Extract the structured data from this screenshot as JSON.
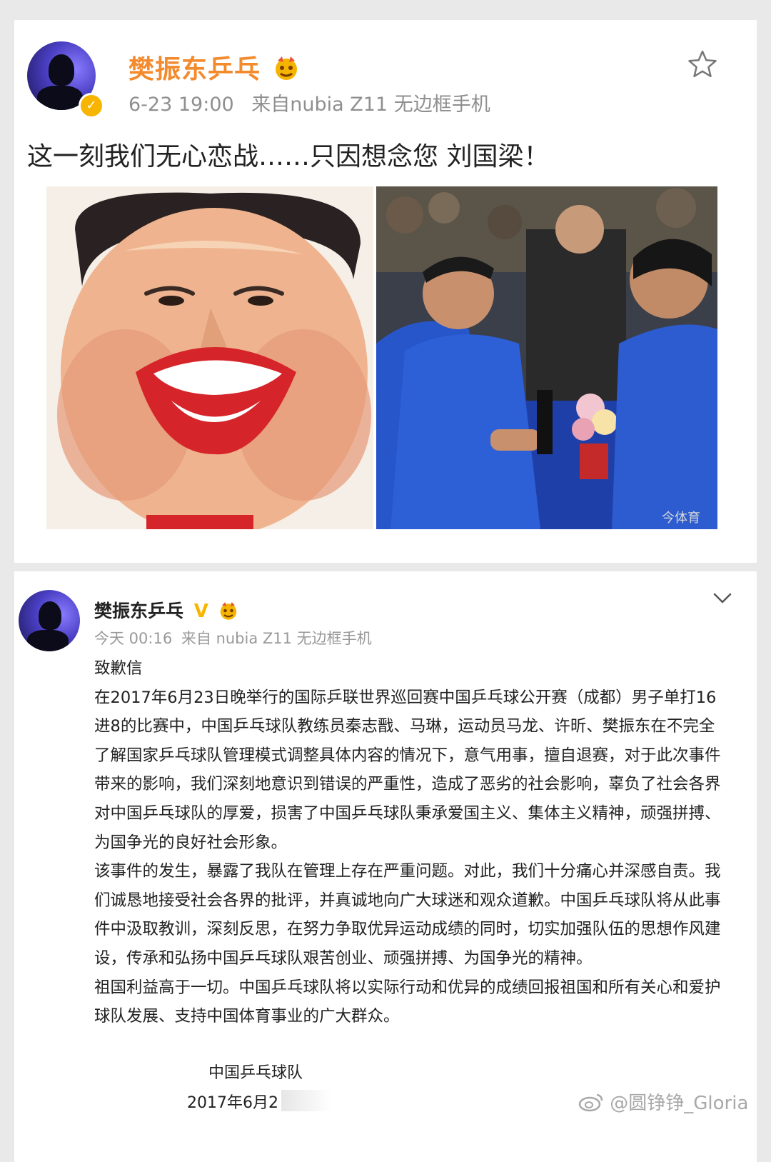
{
  "post1": {
    "username": "樊振东乒乓",
    "timestamp": "6-23 19:00",
    "source": "来自nubia Z11 无边框手机",
    "content": "这一刻我们无心恋战……只因想念您 刘国梁！",
    "image_watermark": "今体育",
    "icons": [
      "avatar",
      "verified-badge",
      "star-icon",
      "emoji-badge"
    ]
  },
  "post2": {
    "username": "樊振东乒乓",
    "timestamp": "今天 00:16",
    "source": "来自 nubia Z11 无边框手机",
    "title": "致歉信",
    "paragraphs": [
      "在2017年6月23日晚举行的国际乒联世界巡回赛中国乒乓球公开赛（成都）男子单打16进8的比赛中，中国乒乓球队教练员秦志戬、马琳，运动员马龙、许昕、樊振东在不完全了解国家乒乓球队管理模式调整具体内容的情况下，意气用事，擅自退赛，对于此次事件带来的影响，我们深刻地意识到错误的严重性，造成了恶劣的社会影响，辜负了社会各界对中国乒乓球队的厚爱，损害了中国乒乓球队秉承爱国主义、集体主义精神，顽强拼搏、为国争光的良好社会形象。",
      "该事件的发生，暴露了我队在管理上存在严重问题。对此，我们十分痛心并深感自责。我们诚恳地接受社会各界的批评，并真诚地向广大球迷和观众道歉。中国乒乓球队将从此事件中汲取教训，深刻反思，在努力争取优异运动成绩的同时，切实加强队伍的思想作风建设，传承和弘扬中国乒乓球队艰苦创业、顽强拼搏、为国争光的精神。",
      "祖国利益高于一切。中国乒乓球队将以实际行动和优异的成绩回报祖国和所有关心和爱护球队发展、支持中国体育事业的广大群众。"
    ],
    "signature": "中国乒乓球队",
    "date": "2017年6月2",
    "icons": [
      "avatar",
      "verified-v-icon",
      "emoji-badge",
      "chevron-down-icon"
    ]
  },
  "watermark": "@圆铮铮_Gloria",
  "colors": {
    "username_orange": "#f38a2c",
    "meta_gray": "#8f8f8f",
    "verified_gold": "#f7b500"
  }
}
